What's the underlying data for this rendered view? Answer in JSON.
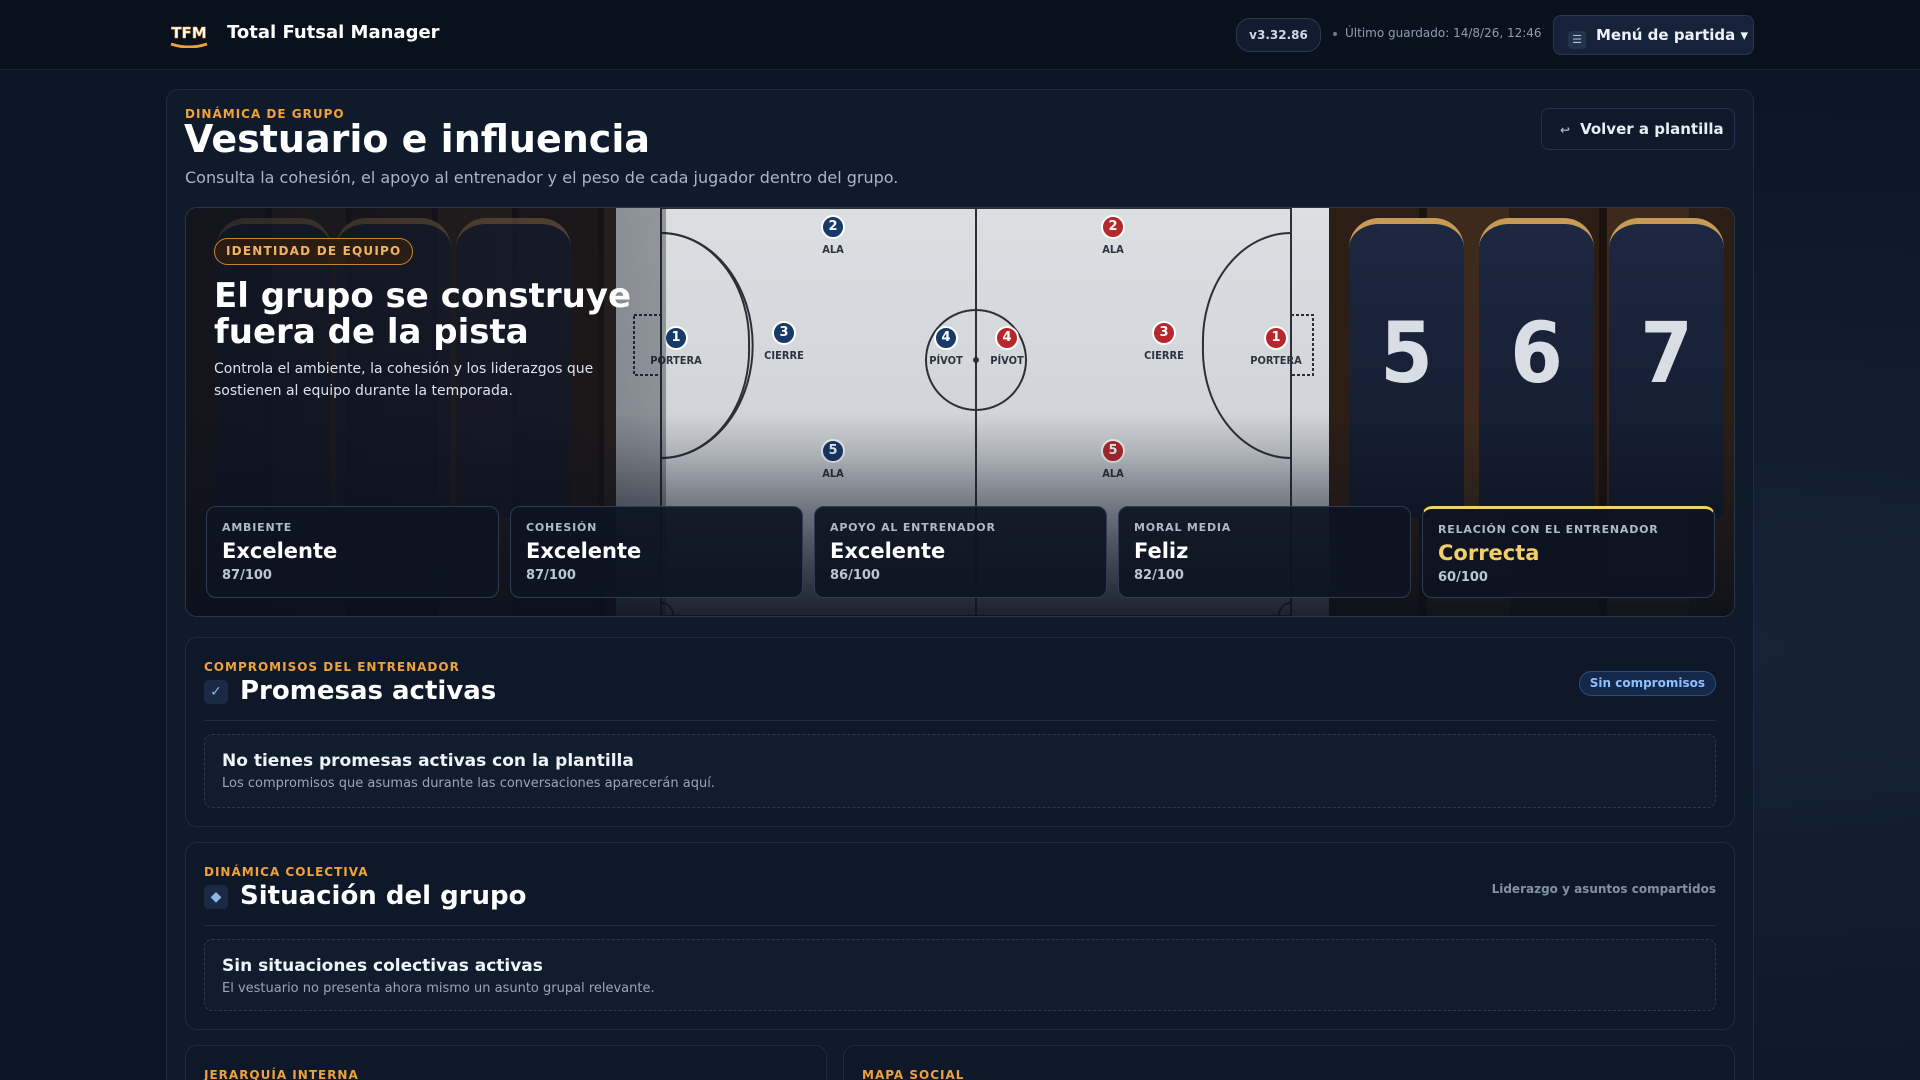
{
  "header": {
    "logo_text": "TFM",
    "app_title": "Total Futsal Manager",
    "version": "v3.32.86",
    "last_saved": "Último guardado: 14/8/26, 12:46",
    "menu_label": "Menú de partida ▾"
  },
  "page": {
    "eyebrow": "DINÁMICA DE GRUPO",
    "title": "Vestuario e influencia",
    "subtitle": "Consulta la cohesión, el apoyo al entrenador y el peso de cada jugador dentro del grupo.",
    "back_label": "Volver a plantilla"
  },
  "hero": {
    "badge": "IDENTIDAD DE EQUIPO",
    "title": "El grupo se construye fuera de la pista",
    "description": "Controla el ambiente, la cohesión y los liderazgos que sostienen al equipo durante la temporada.",
    "jerseys": [
      "5",
      "6",
      "7"
    ],
    "players": [
      {
        "team": "blue",
        "num": "1",
        "role": "PORTERA"
      },
      {
        "team": "blue",
        "num": "2",
        "role": "ALA"
      },
      {
        "team": "blue",
        "num": "3",
        "role": "CIERRE"
      },
      {
        "team": "blue",
        "num": "4",
        "role": "PÍVOT"
      },
      {
        "team": "blue",
        "num": "5",
        "role": "ALA"
      },
      {
        "team": "red",
        "num": "4",
        "role": "PÍVOT"
      },
      {
        "team": "red",
        "num": "2",
        "role": "ALA"
      },
      {
        "team": "red",
        "num": "3",
        "role": "CIERRE"
      },
      {
        "team": "red",
        "num": "5",
        "role": "ALA"
      },
      {
        "team": "red",
        "num": "1",
        "role": "PORTERA"
      }
    ],
    "stats": [
      {
        "label": "AMBIENTE",
        "value": "Excelente",
        "score": "87/100"
      },
      {
        "label": "COHESIÓN",
        "value": "Excelente",
        "score": "87/100"
      },
      {
        "label": "APOYO AL ENTRENADOR",
        "value": "Excelente",
        "score": "86/100"
      },
      {
        "label": "MORAL MEDIA",
        "value": "Feliz",
        "score": "82/100"
      },
      {
        "label": "RELACIÓN CON EL ENTRENADOR",
        "value": "Correcta",
        "score": "60/100"
      }
    ]
  },
  "promises": {
    "eyebrow": "COMPROMISOS DEL ENTRENADOR",
    "icon": "✓",
    "title": "Promesas activas",
    "pill": "Sin compromisos",
    "empty_title": "No tienes promesas activas con la plantilla",
    "empty_desc": "Los compromisos que asumas durante las conversaciones aparecerán aquí."
  },
  "group": {
    "eyebrow": "DINÁMICA COLECTIVA",
    "icon": "◆",
    "title": "Situación del grupo",
    "note": "Liderazgo y asuntos compartidos",
    "empty_title": "Sin situaciones colectivas activas",
    "empty_desc": "El vestuario no presenta ahora mismo un asunto grupal relevante."
  },
  "bottom": {
    "left_eyebrow": "JERARQUÍA INTERNA",
    "right_eyebrow": "MAPA SOCIAL"
  },
  "colors": {
    "accent_orange": "#f0a13c",
    "highlight_gold": "#f3cf6a",
    "blue_team": "#173a68",
    "red_team": "#b7282c"
  }
}
